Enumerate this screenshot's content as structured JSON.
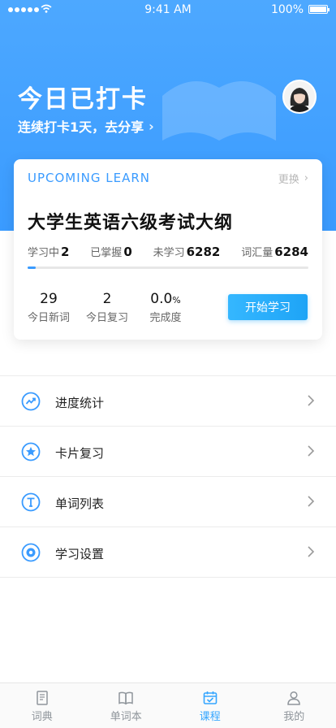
{
  "status_bar": {
    "time": "9:41 AM",
    "battery": "100%"
  },
  "hero": {
    "title": "今日已打卡",
    "subtitle": "连续打卡1天，去分享"
  },
  "card": {
    "upcoming_label": "UPCOMING LEARN",
    "change_label": "更换",
    "course_title": "大学生英语六级考试大纲",
    "stats": {
      "learning_label": "学习中",
      "learning_value": "2",
      "mastered_label": "已掌握",
      "mastered_value": "0",
      "unlearned_label": "未学习",
      "unlearned_value": "6282",
      "vocab_label": "词汇量",
      "vocab_value": "6284"
    },
    "progress_fraction": 0.03,
    "metrics": [
      {
        "value": "29",
        "unit": "",
        "label": "今日新词"
      },
      {
        "value": "2",
        "unit": "",
        "label": "今日复习"
      },
      {
        "value": "0.0",
        "unit": "%",
        "label": "完成度"
      }
    ],
    "start_button": "开始学习"
  },
  "menu": [
    {
      "label": "进度统计",
      "icon": "trend-chart-icon"
    },
    {
      "label": "卡片复习",
      "icon": "star-icon"
    },
    {
      "label": "单词列表",
      "icon": "letter-t-icon"
    },
    {
      "label": "学习设置",
      "icon": "settings-dot-icon"
    }
  ],
  "tabs": [
    {
      "label": "词典",
      "icon": "dictionary-icon",
      "active": false
    },
    {
      "label": "单词本",
      "icon": "book-icon",
      "active": false
    },
    {
      "label": "课程",
      "icon": "calendar-check-icon",
      "active": true
    },
    {
      "label": "我的",
      "icon": "person-icon",
      "active": false
    }
  ],
  "colors": {
    "accent": "#3a9bff",
    "button": "#1ea4f6",
    "tab_active": "#35a6ff"
  }
}
